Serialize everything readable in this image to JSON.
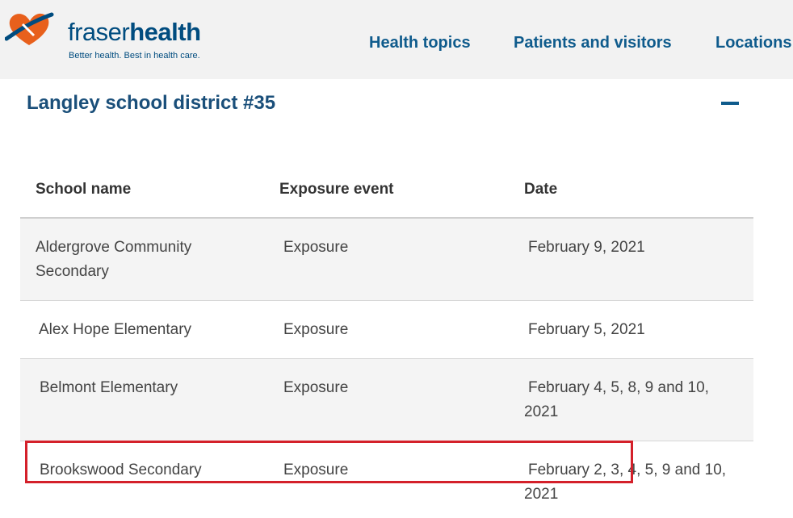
{
  "header": {
    "brand_part1": "fraser",
    "brand_part2": "health",
    "tagline": "Better health. Best in health care.",
    "nav": [
      "Health topics",
      "Patients and visitors",
      "Locations"
    ]
  },
  "section": {
    "title": "Langley school district #35"
  },
  "table": {
    "headers": [
      "School name",
      "Exposure event",
      "Date"
    ],
    "rows": [
      {
        "school": "Aldergrove Community Secondary",
        "event": "Exposure",
        "date": "February 9, 2021"
      },
      {
        "school": "Alex Hope Elementary",
        "event": "Exposure",
        "date": "February 5, 2021"
      },
      {
        "school": "Belmont Elementary",
        "event": "Exposure",
        "date": "February 4, 5, 8, 9 and 10, 2021"
      },
      {
        "school": "Brookswood Secondary",
        "event": "Exposure",
        "date": "February 2, 3, 4, 5, 9 and 10, 2021"
      }
    ]
  },
  "colors": {
    "brand": "#004c7f",
    "accent": "#e8601c",
    "highlight": "#d4202a"
  }
}
